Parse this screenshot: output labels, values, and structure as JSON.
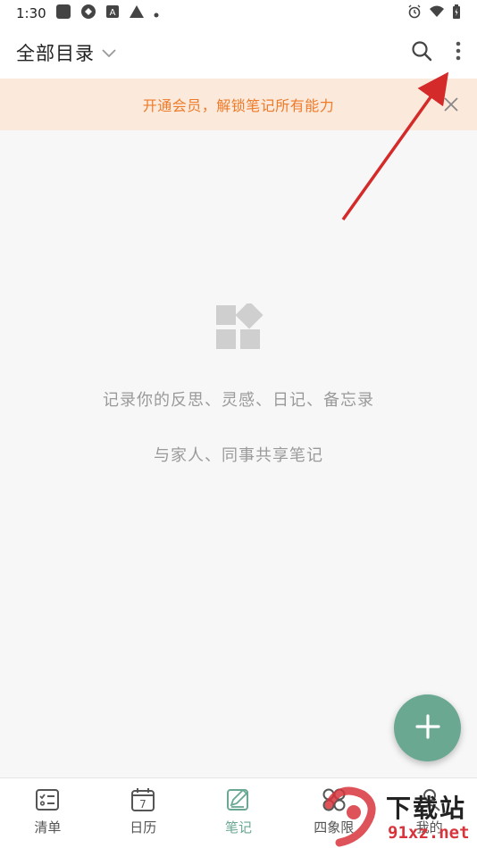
{
  "status_bar": {
    "time": "1:30"
  },
  "app_bar": {
    "title": "全部目录"
  },
  "banner": {
    "text": "开通会员，解锁笔记所有能力"
  },
  "empty_state": {
    "line1": "记录你的反思、灵感、日记、备忘录",
    "line2": "与家人、同事共享笔记"
  },
  "calendar_icon_day": "7",
  "bottom_nav": {
    "items": [
      {
        "label": "清单",
        "icon": "checklist-icon"
      },
      {
        "label": "日历",
        "icon": "calendar-icon"
      },
      {
        "label": "笔记",
        "icon": "note-edit-icon",
        "active": true
      },
      {
        "label": "四象限",
        "icon": "quadrant-icon"
      },
      {
        "label": "我的",
        "icon": "profile-icon"
      }
    ]
  },
  "watermark": {
    "text1": "下载站",
    "text2": "91xz.net"
  },
  "colors": {
    "accent": "#6aa892",
    "banner_bg": "#fbeadb",
    "banner_text": "#ee7a2a",
    "annotation_arrow": "#d42a2a"
  }
}
